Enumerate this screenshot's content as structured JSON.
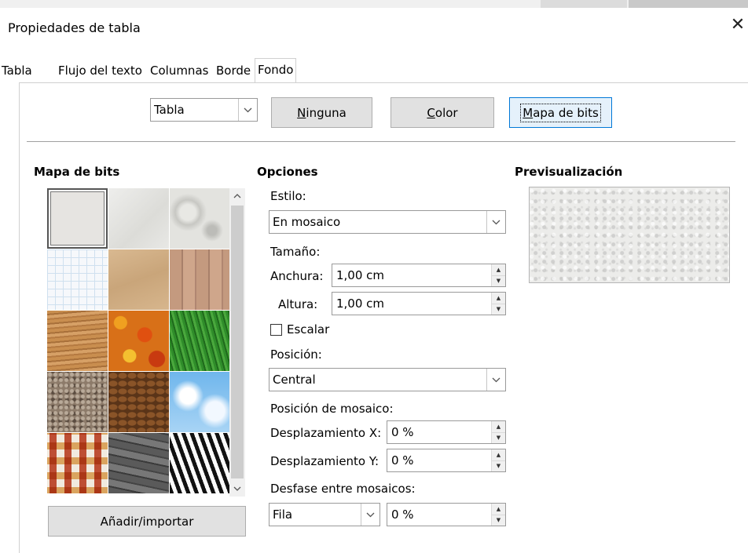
{
  "window": {
    "title": "Propiedades de tabla",
    "close_glyph": "✕"
  },
  "tabs": [
    {
      "label": "Tabla",
      "active": false
    },
    {
      "label": "Flujo del texto",
      "active": false
    },
    {
      "label": "Columnas",
      "active": false
    },
    {
      "label": "Borde",
      "active": false
    },
    {
      "label": "Fondo",
      "active": true
    }
  ],
  "toolbar": {
    "target_select": {
      "value": "Tabla"
    },
    "buttons": [
      {
        "label_pre": "",
        "label_ul": "N",
        "label_post": "inguna",
        "selected": false
      },
      {
        "label_pre": "",
        "label_ul": "C",
        "label_post": "olor",
        "selected": false
      },
      {
        "label_pre": "",
        "label_ul": "M",
        "label_post": "apa de bits",
        "selected": true
      }
    ]
  },
  "bitmap_panel": {
    "heading": "Mapa de bits",
    "tiles": [
      "painted-white",
      "paper-texture",
      "paper-crumpled",
      "pool-tiles",
      "cardboard",
      "wood-planks",
      "wood-grain",
      "autumn-leaves",
      "grass",
      "pebbles",
      "coffee-beans",
      "sky-clouds",
      "color-squares",
      "stone-wall",
      "zebra"
    ],
    "selected_index": 0,
    "add_button": "Añadir/importar"
  },
  "options": {
    "heading": "Opciones",
    "style_label": "Estilo:",
    "style_value": "En mosaico",
    "size_label": "Tamaño:",
    "width_label": "Anchura:",
    "width_value": "1,00 cm",
    "height_label": "Altura:",
    "height_value": "1,00 cm",
    "scale_label": "Escalar",
    "scale_checked": false,
    "position_label": "Posición:",
    "position_value": "Central",
    "tile_position_label": "Posición de mosaico:",
    "offset_x_label": "Desplazamiento X:",
    "offset_x_value": "0 %",
    "offset_y_label": "Desplazamiento Y:",
    "offset_y_value": "0 %",
    "tile_offset_label": "Desfase entre mosaicos:",
    "tile_offset_mode": "Fila",
    "tile_offset_value": "0 %"
  },
  "preview": {
    "heading": "Previsualización"
  },
  "colors": {
    "accent": "#0078d7",
    "button_bg": "#e1e1e1",
    "selected_bg": "#e5f1fb"
  }
}
